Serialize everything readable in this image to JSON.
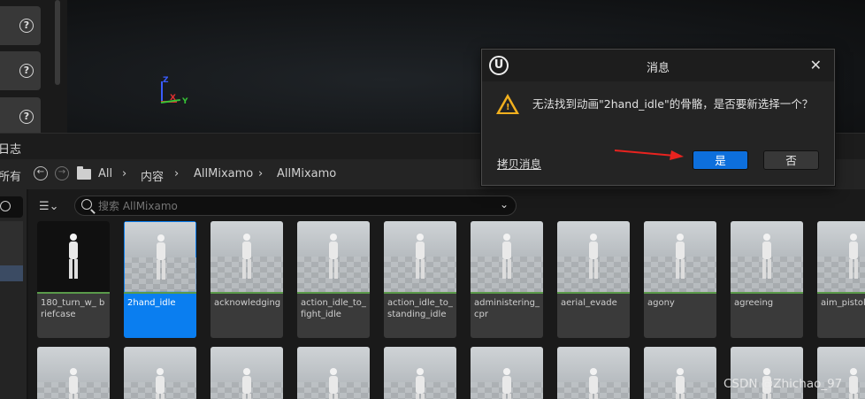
{
  "dialog": {
    "title": "消息",
    "message": "无法找到动画\"2hand_idle\"的骨骼，是否要新选择一个？",
    "copy_label": "拷贝消息",
    "yes_label": "是",
    "no_label": "否",
    "logo_text": "U"
  },
  "content_browser": {
    "panel_title": "日志",
    "save_all_label": "所有",
    "breadcrumb": [
      "All",
      "内容",
      "AllMixamo",
      "AllMixamo"
    ],
    "search_placeholder": "搜索 AllMixamo",
    "assets": [
      {
        "name": "180_turn_w_ briefcase",
        "selected": false,
        "dark": true
      },
      {
        "name": "2hand_idle",
        "selected": true,
        "dark": false
      },
      {
        "name": "acknowledging",
        "selected": false,
        "dark": false
      },
      {
        "name": "action_idle_to_ fight_idle",
        "selected": false,
        "dark": false
      },
      {
        "name": "action_idle_to_ standing_idle",
        "selected": false,
        "dark": false
      },
      {
        "name": "administering_ cpr",
        "selected": false,
        "dark": false
      },
      {
        "name": "aerial_evade",
        "selected": false,
        "dark": false
      },
      {
        "name": "agony",
        "selected": false,
        "dark": false
      },
      {
        "name": "agreeing",
        "selected": false,
        "dark": false
      },
      {
        "name": "aim_pistol",
        "selected": false,
        "dark": false
      }
    ]
  },
  "viewport": {
    "gizmo_z": "Z",
    "gizmo_x": "X",
    "gizmo_y": "Y"
  },
  "icons": {
    "help": "?",
    "back": "←",
    "forward": "→",
    "chevron": "›",
    "close": "✕"
  },
  "watermark": "CSDN @Zhichao_97",
  "colors": {
    "accent_blue": "#0d6fdc",
    "selection_blue": "#0a7ef0",
    "warning": "#f2b01e",
    "annotation_arrow": "#e8231f"
  }
}
